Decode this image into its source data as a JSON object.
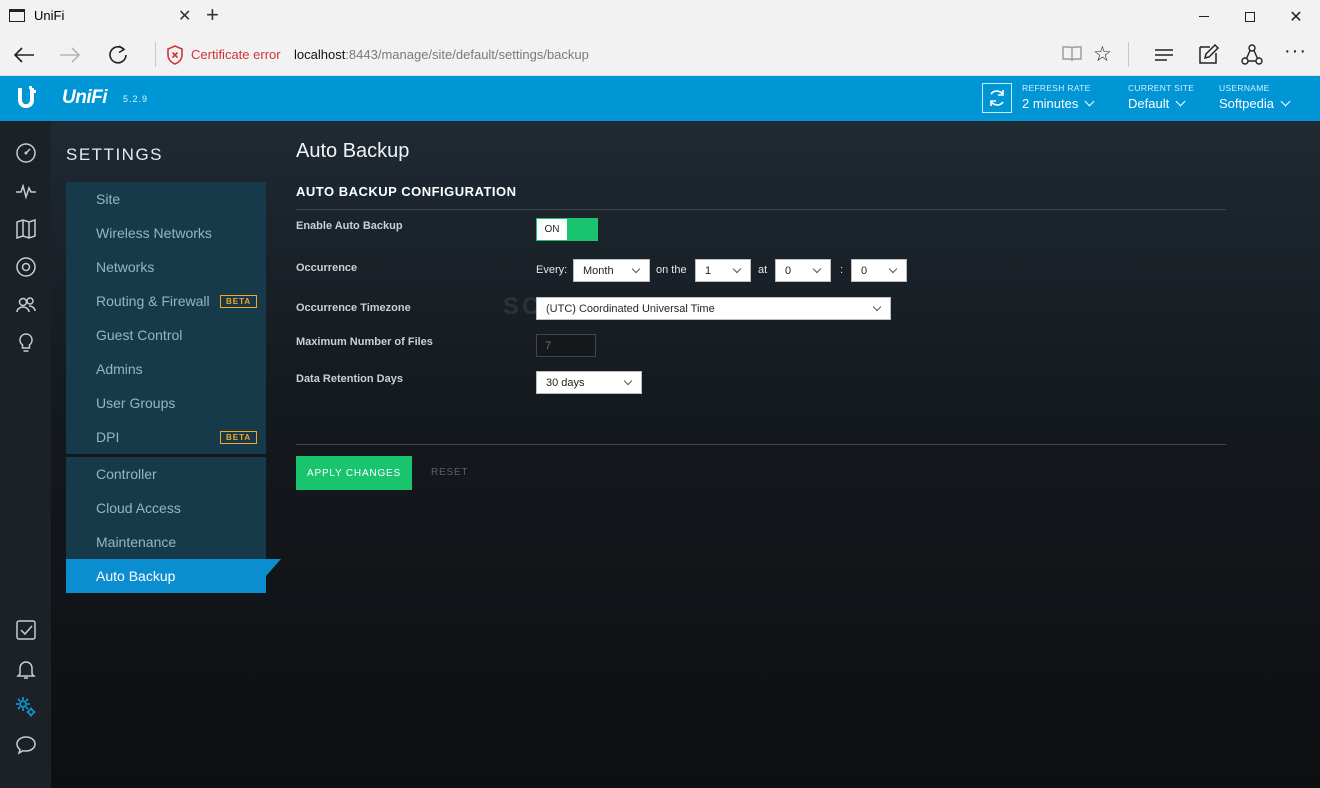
{
  "browser": {
    "tab_title": "UniFi",
    "cert_error": "Certificate error",
    "url_host": "localhost",
    "url_rest": ":8443/manage/site/default/settings/backup"
  },
  "header": {
    "logo": "UniFi",
    "version": "5.2.9",
    "refresh_rate": {
      "label": "REFRESH RATE",
      "value": "2 minutes"
    },
    "current_site": {
      "label": "CURRENT SITE",
      "value": "Default"
    },
    "username": {
      "label": "USERNAME",
      "value": "Softpedia"
    }
  },
  "iconbar": {
    "top_icons": [
      "dashboard-icon",
      "statistics-icon",
      "map-icon",
      "devices-icon",
      "clients-icon",
      "insights-icon"
    ],
    "bottom_icons": [
      "tasks-icon",
      "alerts-icon",
      "settings-icon",
      "chat-icon"
    ]
  },
  "settings": {
    "title": "SETTINGS",
    "menu_group1": [
      {
        "label": "Site"
      },
      {
        "label": "Wireless Networks"
      },
      {
        "label": "Networks"
      },
      {
        "label": "Routing & Firewall",
        "badge": "BETA"
      },
      {
        "label": "Guest Control"
      },
      {
        "label": "Admins"
      },
      {
        "label": "User Groups"
      },
      {
        "label": "DPI",
        "badge": "BETA"
      }
    ],
    "menu_group2": [
      {
        "label": "Controller"
      },
      {
        "label": "Cloud Access"
      },
      {
        "label": "Maintenance"
      }
    ],
    "active_item": "Auto Backup"
  },
  "main": {
    "page_title": "Auto Backup",
    "section_title": "AUTO BACKUP CONFIGURATION",
    "enable": {
      "label": "Enable Auto Backup",
      "state": "ON"
    },
    "occurrence": {
      "label": "Occurrence",
      "every_label": "Every:",
      "frequency": "Month",
      "on_the_label": "on the",
      "day": "1",
      "at_label": "at",
      "hour": "0",
      "colon": ":",
      "minute": "0"
    },
    "timezone": {
      "label": "Occurrence Timezone",
      "value": "(UTC) Coordinated Universal Time"
    },
    "max_files": {
      "label": "Maximum Number of Files",
      "value": "7"
    },
    "retention": {
      "label": "Data Retention Days",
      "value": "30 days"
    },
    "apply_label": "APPLY CHANGES",
    "reset_label": "RESET",
    "watermark": "SOFTPEDIA"
  },
  "colors": {
    "header_blue": "#0096d6",
    "accent_green": "#19c46f",
    "menu_active": "#0b8ed0",
    "beta_orange": "#f5a623"
  }
}
